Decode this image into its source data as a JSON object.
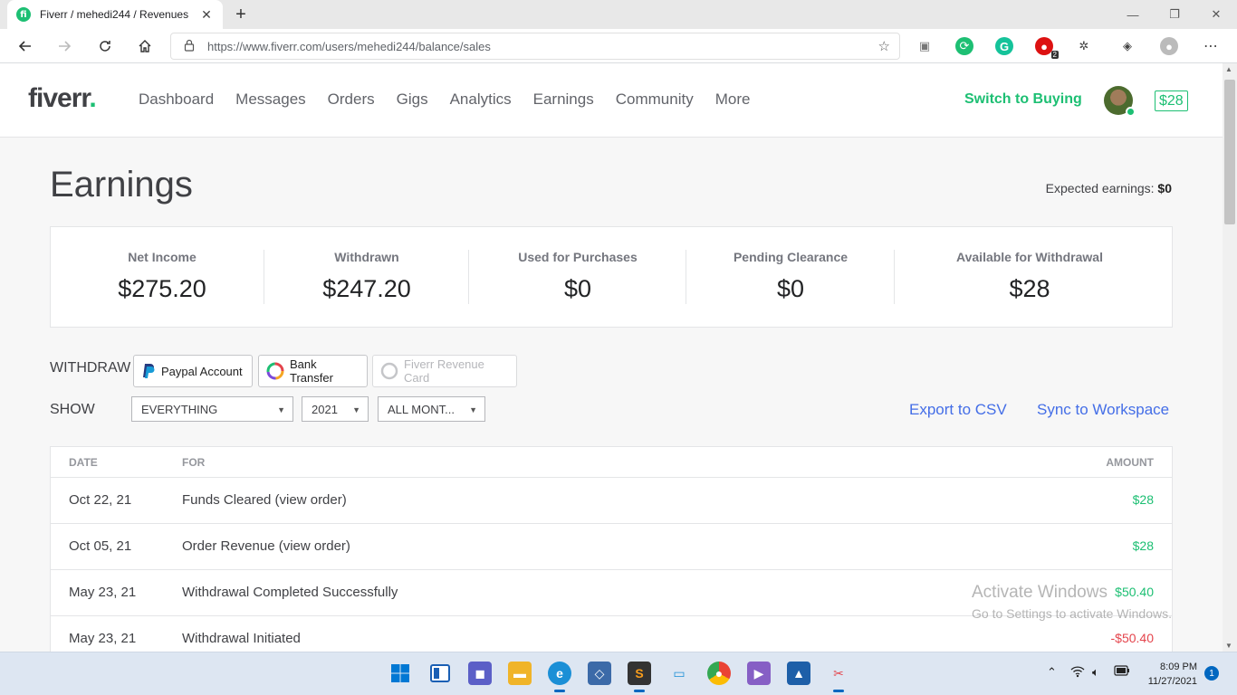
{
  "browser": {
    "tab_title": "Fiverr / mehedi244 / Revenues",
    "tab_close": "✕",
    "new_tab": "+",
    "url": "https://www.fiverr.com/users/mehedi244/balance/sales",
    "window_controls": {
      "minimize": "—",
      "maximize": "❐",
      "close": "✕"
    },
    "extension_badge": "2"
  },
  "header": {
    "logo_text": "fiverr",
    "logo_dot": ".",
    "nav": [
      "Dashboard",
      "Messages",
      "Orders",
      "Gigs",
      "Analytics",
      "Earnings",
      "Community",
      "More"
    ],
    "switch_label": "Switch to Buying",
    "balance": "$28"
  },
  "page": {
    "title": "Earnings",
    "expected_label": "Expected earnings: ",
    "expected_value": "$0"
  },
  "stats": [
    {
      "label": "Net Income",
      "value": "$275.20"
    },
    {
      "label": "Withdrawn",
      "value": "$247.20"
    },
    {
      "label": "Used for Purchases",
      "value": "$0"
    },
    {
      "label": "Pending Clearance",
      "value": "$0"
    },
    {
      "label": "Available for Withdrawal",
      "value": "$28"
    }
  ],
  "withdraw": {
    "label": "WITHDRAW",
    "paypal": "Paypal Account",
    "bank": "Bank Transfer",
    "card": "Fiverr Revenue Card"
  },
  "filters": {
    "label": "SHOW",
    "type": "EVERYTHING",
    "year": "2021",
    "month": "ALL MONT...",
    "export": "Export to CSV",
    "sync": "Sync to Workspace"
  },
  "table": {
    "headers": {
      "date": "DATE",
      "for": "FOR",
      "amount": "AMOUNT"
    },
    "rows": [
      {
        "date": "Oct 22, 21",
        "for": "Funds Cleared (view order)",
        "amount": "$28"
      },
      {
        "date": "Oct 05, 21",
        "for": "Order Revenue (view order)",
        "amount": "$28"
      },
      {
        "date": "May 23, 21",
        "for": "Withdrawal Completed Successfully",
        "amount": "$50.40"
      },
      {
        "date": "May 23, 21",
        "for": "Withdrawal Initiated",
        "amount": "-$50.40"
      }
    ]
  },
  "watermark": {
    "line1": "Activate Windows",
    "line2": "Go to Settings to activate Windows."
  },
  "taskbar": {
    "time": "8:09 PM",
    "date": "11/27/2021",
    "notifications": "1"
  },
  "colors": {
    "brand_green": "#1dbf73",
    "link_blue": "#446ee7",
    "negative_red": "#e4444c"
  }
}
